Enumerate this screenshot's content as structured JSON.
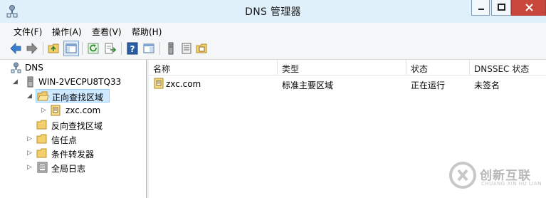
{
  "window": {
    "title": "DNS 管理器"
  },
  "menubar": {
    "items": [
      {
        "label": "文件(F)"
      },
      {
        "label": "操作(A)"
      },
      {
        "label": "查看(V)"
      },
      {
        "label": "帮助(H)"
      }
    ]
  },
  "toolbar": {
    "icons": [
      "back-arrow-icon",
      "forward-arrow-icon",
      "up-folder-icon",
      "show-hide-tree-icon",
      "refresh-icon",
      "export-list-icon",
      "help-icon",
      "properties-pane-icon",
      "server-icon",
      "list-icon",
      "zone-icon"
    ]
  },
  "tree": {
    "root": "DNS",
    "server": "WIN-2VECPU8TQ33",
    "forward_zones": "正向查找区域",
    "zone": "zxc.com",
    "reverse_zones": "反向查找区域",
    "trust_points": "信任点",
    "conditional_forwarders": "条件转发器",
    "global_logs": "全局日志"
  },
  "list": {
    "columns": [
      "名称",
      "类型",
      "状态",
      "DNSSEC 状态"
    ],
    "rows": [
      {
        "name": "zxc.com",
        "type": "标准主要区域",
        "status": "正在运行",
        "dnssec": "未签名"
      }
    ]
  },
  "watermark": {
    "title": "创新互联",
    "subtitle": "CHUANG XIN HU LIAN"
  },
  "colors": {
    "title_bg": "#dff0fb",
    "close_btn": "#c9463d",
    "selection": "#cde8ff"
  }
}
